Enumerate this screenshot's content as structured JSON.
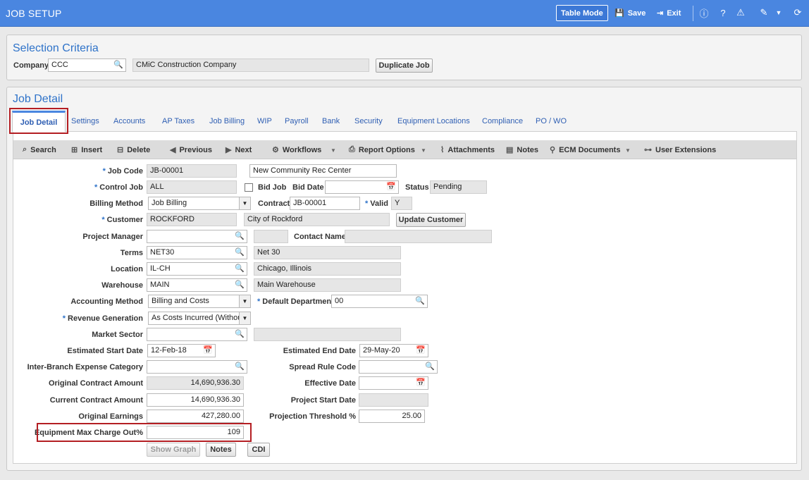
{
  "app": {
    "title": "JOB SETUP",
    "table_mode": "Table Mode",
    "save": "Save",
    "exit": "Exit"
  },
  "selection": {
    "title": "Selection Criteria",
    "company_label": "Company",
    "company_value": "CCC",
    "company_name": "CMiC Construction Company",
    "duplicate_button": "Duplicate Job"
  },
  "detail": {
    "title": "Job Detail",
    "tabs": [
      "Job Detail",
      "Settings",
      "Accounts",
      "AP Taxes",
      "Job Billing",
      "WIP",
      "Payroll",
      "Bank",
      "Security",
      "Equipment Locations",
      "Compliance",
      "PO / WO"
    ],
    "toolbar": {
      "search": "Search",
      "insert": "Insert",
      "delete": "Delete",
      "previous": "Previous",
      "next": "Next",
      "workflows": "Workflows",
      "report_options": "Report Options",
      "attachments": "Attachments",
      "notes": "Notes",
      "ecm_documents": "ECM Documents",
      "user_extensions": "User Extensions"
    }
  },
  "form": {
    "job_code": {
      "label": "Job Code",
      "value": "JB-00001",
      "name": "New Community Rec Center"
    },
    "control_job": {
      "label": "Control Job",
      "value": "ALL"
    },
    "bid_job": {
      "label": "Bid Job",
      "checked": false
    },
    "bid_date": {
      "label": "Bid Date",
      "value": ""
    },
    "status": {
      "label": "Status",
      "value": "Pending"
    },
    "billing_method": {
      "label": "Billing Method",
      "value": "Job Billing"
    },
    "contract": {
      "label": "Contract",
      "value": "JB-00001"
    },
    "valid": {
      "label": "Valid",
      "value": "Y"
    },
    "customer": {
      "label": "Customer",
      "value": "ROCKFORD",
      "name": "City of Rockford",
      "update_button": "Update Customer"
    },
    "project_manager": {
      "label": "Project Manager",
      "value": "",
      "name": ""
    },
    "contact_name": {
      "label": "Contact Name",
      "value": ""
    },
    "terms": {
      "label": "Terms",
      "value": "NET30",
      "desc": "Net 30"
    },
    "location": {
      "label": "Location",
      "value": "IL-CH",
      "desc": "Chicago, Illinois"
    },
    "warehouse": {
      "label": "Warehouse",
      "value": "MAIN",
      "desc": "Main Warehouse"
    },
    "accounting_method": {
      "label": "Accounting Method",
      "value": "Billing and Costs"
    },
    "default_department": {
      "label": "Default Department",
      "value": "00"
    },
    "revenue_generation": {
      "label": "Revenue Generation",
      "value": "As Costs Incurred (Without"
    },
    "market_sector": {
      "label": "Market Sector",
      "value": "",
      "desc": ""
    },
    "est_start_date": {
      "label": "Estimated Start Date",
      "value": "12-Feb-18"
    },
    "est_end_date": {
      "label": "Estimated End Date",
      "value": "29-May-20"
    },
    "inter_branch": {
      "label": "Inter-Branch Expense Category",
      "value": ""
    },
    "spread_rule": {
      "label": "Spread Rule Code",
      "value": ""
    },
    "original_contract": {
      "label": "Original Contract Amount",
      "value": "14,690,936.30"
    },
    "effective_date": {
      "label": "Effective Date",
      "value": ""
    },
    "current_contract": {
      "label": "Current Contract Amount",
      "value": "14,690,936.30"
    },
    "project_start_date": {
      "label": "Project Start Date",
      "value": ""
    },
    "original_earnings": {
      "label": "Original Earnings",
      "value": "427,280.00"
    },
    "projection_threshold": {
      "label": "Projection Threshold %",
      "value": "25.00"
    },
    "equipment_max": {
      "label": "Equipment Max Charge Out%",
      "value": "109"
    },
    "buttons": {
      "show_graph": "Show Graph",
      "notes": "Notes",
      "cdi": "CDI"
    }
  }
}
